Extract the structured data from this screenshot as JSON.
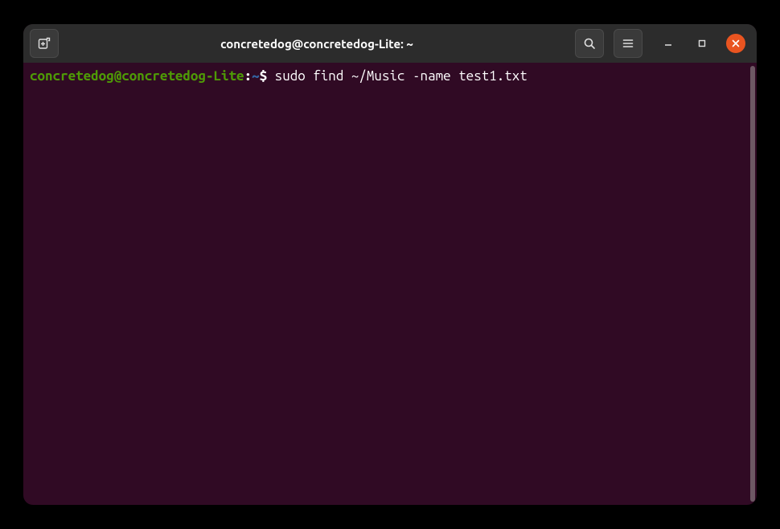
{
  "window": {
    "title": "concretedog@concretedog-Lite: ~"
  },
  "prompt": {
    "user_host": "concretedog@concretedog-Lite",
    "separator1": ":",
    "path": "~",
    "separator2": "$ ",
    "command": "sudo find ~/Music -name test1.txt"
  }
}
